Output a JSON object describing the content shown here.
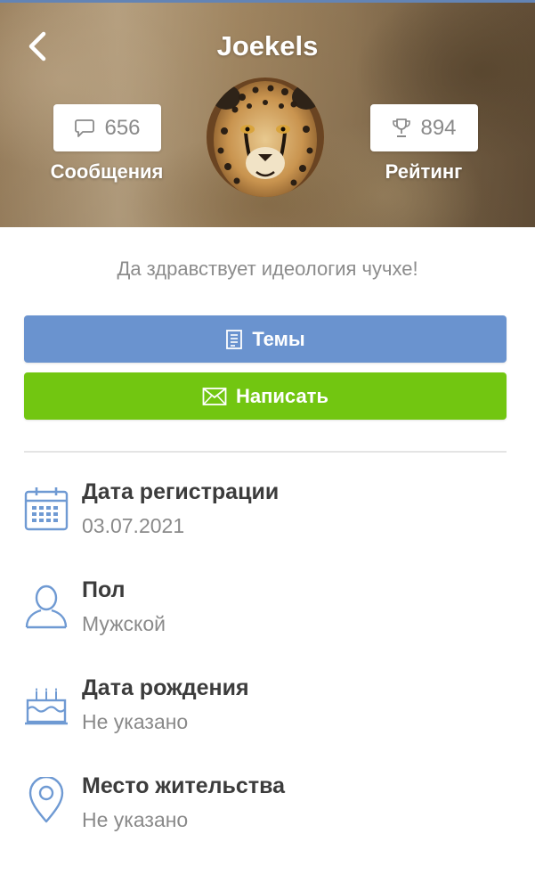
{
  "header": {
    "title": "Joekels",
    "messages": {
      "count": "656",
      "label": "Сообщения",
      "icon": "chat-bubble-icon"
    },
    "rating": {
      "count": "894",
      "label": "Рейтинг",
      "icon": "trophy-icon"
    }
  },
  "profile": {
    "status": "Да здравствует идеология чучхе!"
  },
  "actions": {
    "topics_label": "Темы",
    "write_label": "Написать"
  },
  "info": [
    {
      "title": "Дата регистрации",
      "value": "03.07.2021",
      "icon": "calendar-icon"
    },
    {
      "title": "Пол",
      "value": "Мужской",
      "icon": "user-icon"
    },
    {
      "title": "Дата рождения",
      "value": "Не указано",
      "icon": "cake-icon"
    },
    {
      "title": "Место жительства",
      "value": "Не указано",
      "icon": "location-pin-icon"
    }
  ],
  "colors": {
    "topics_button": "#6a93cf",
    "write_button": "#72c611",
    "icon_blue": "#6f9ad3",
    "title_text": "#3c3c3c",
    "muted_text": "#8a8a8a"
  }
}
